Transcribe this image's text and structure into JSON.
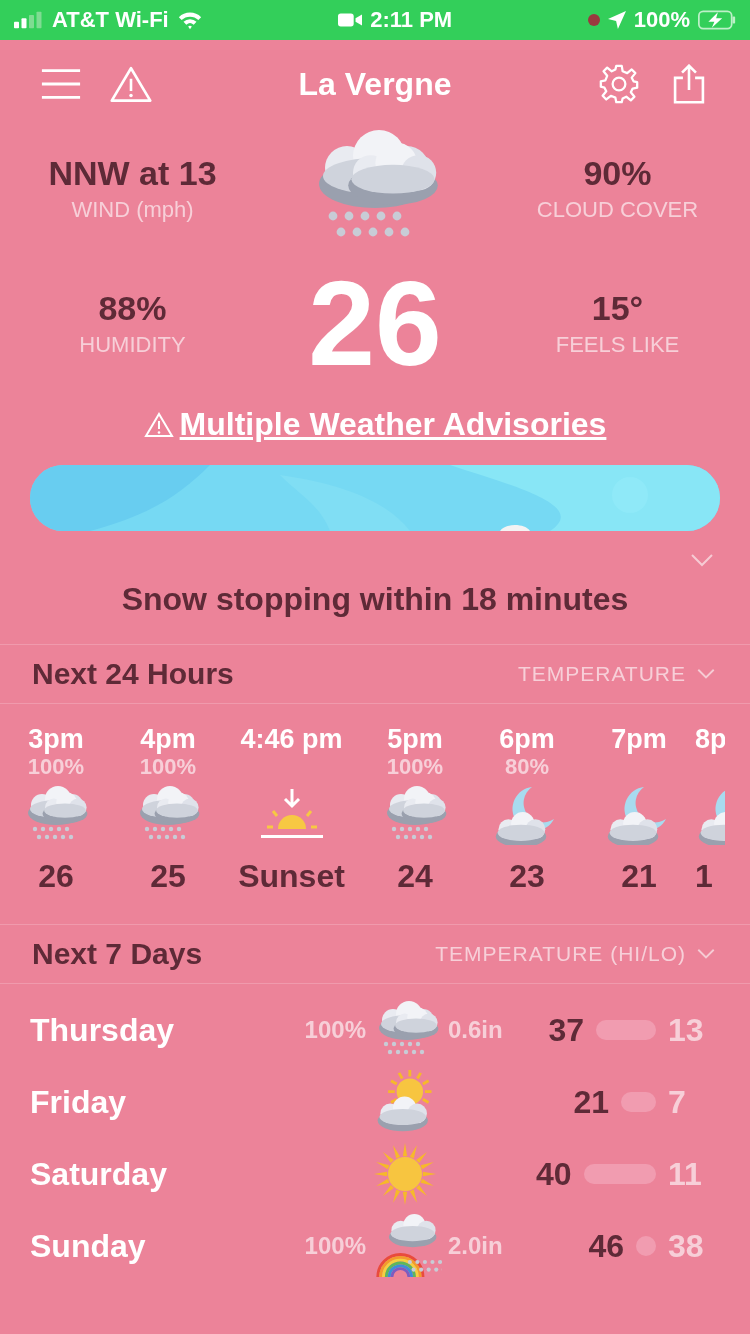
{
  "status_bar": {
    "carrier": "AT&T Wi-Fi",
    "time": "2:11 PM",
    "battery": "100%"
  },
  "header": {
    "title": "La Vergne"
  },
  "current": {
    "kind": "snow",
    "temperature": "26",
    "stats": [
      {
        "value": "NNW at 13",
        "label": "WIND (mph)"
      },
      {
        "value": "90%",
        "label": "CLOUD COVER"
      },
      {
        "value": "88%",
        "label": "HUMIDITY"
      },
      {
        "value": "15°",
        "label": "FEELS LIKE"
      }
    ]
  },
  "advisory": "Multiple Weather Advisories",
  "summary": "Snow stopping within 18 minutes",
  "hourly": {
    "title": "Next 24 Hours",
    "selector": "TEMPERATURE",
    "items": [
      {
        "kind": "snow",
        "time": "3pm",
        "precip": "100%",
        "value": "26"
      },
      {
        "kind": "snow",
        "time": "4pm",
        "precip": "100%",
        "value": "25"
      },
      {
        "kind": "sunset",
        "time": "4:46 pm",
        "value": "Sunset"
      },
      {
        "kind": "snow",
        "time": "5pm",
        "precip": "100%",
        "value": "24"
      },
      {
        "kind": "moon",
        "time": "6pm",
        "precip": "80%",
        "value": "23"
      },
      {
        "kind": "moon",
        "time": "7pm",
        "value": "21"
      },
      {
        "kind": "moon",
        "time": "8p",
        "value": "1"
      }
    ]
  },
  "daily": {
    "title": "Next 7 Days",
    "selector": "TEMPERATURE (HI/LO)",
    "days": [
      {
        "kind": "snow",
        "day": "Thursday",
        "precip": "100%",
        "amount": "0.6in",
        "high": "37",
        "low": "13"
      },
      {
        "kind": "partly",
        "day": "Friday",
        "high": "21",
        "low": "7"
      },
      {
        "kind": "sun",
        "day": "Saturday",
        "high": "40",
        "low": "11"
      },
      {
        "kind": "rainbow",
        "day": "Sunday",
        "precip": "100%",
        "amount": "2.0in",
        "high": "46",
        "low": "38"
      }
    ]
  }
}
